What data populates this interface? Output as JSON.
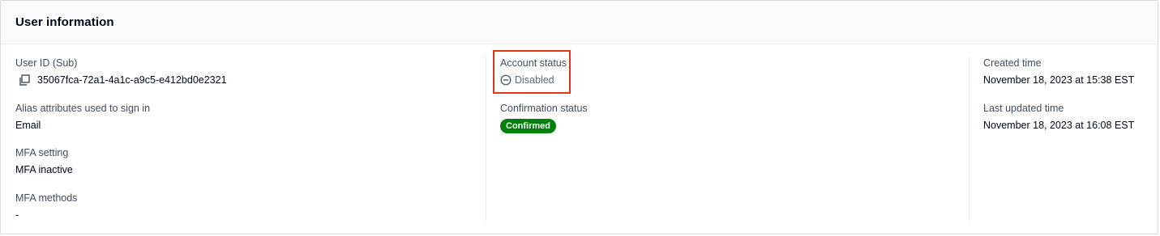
{
  "panel": {
    "title": "User information"
  },
  "column1": {
    "user_id": {
      "label": "User ID (Sub)",
      "value": "35067fca-72a1-4a1c-a9c5-e412bd0e2321",
      "icon": "copy-icon"
    },
    "alias": {
      "label": "Alias attributes used to sign in",
      "value": "Email"
    },
    "mfa_setting": {
      "label": "MFA setting",
      "value": "MFA inactive"
    },
    "mfa_methods": {
      "label": "MFA methods",
      "value": "-"
    }
  },
  "column2": {
    "account_status": {
      "label": "Account status",
      "value": "Disabled",
      "icon": "disabled-circle-icon",
      "highlight_color": "#e1341e"
    },
    "confirmation_status": {
      "label": "Confirmation status",
      "value": "Confirmed",
      "badge_color": "#037f0c"
    }
  },
  "column3": {
    "created_time": {
      "label": "Created time",
      "value": "November 18, 2023 at 15:38 EST"
    },
    "last_updated_time": {
      "label": "Last updated time",
      "value": "November 18, 2023 at 16:08 EST"
    }
  }
}
